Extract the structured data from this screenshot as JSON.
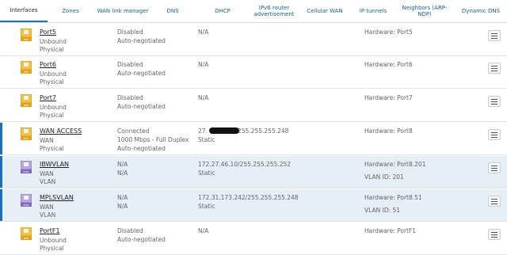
{
  "tabs": [
    {
      "label": "Interfaces"
    },
    {
      "label": "Zones"
    },
    {
      "label": "WAN link manager"
    },
    {
      "label": "DNS"
    },
    {
      "label": "DHCP"
    },
    {
      "label": "IPv6 router advertisement"
    },
    {
      "label": "Cellular WAN"
    },
    {
      "label": "IP tunnels"
    },
    {
      "label": "Neighbors (ARP-NDP)"
    },
    {
      "label": "Dynamic DNS"
    }
  ],
  "icon_text": {
    "eth": "eth",
    "vlan": "vlan"
  },
  "interfaces": [
    {
      "name": "Port5",
      "zone": "Unbound",
      "type": "Physical",
      "status": "Disabled",
      "speed": "Auto-negotiated",
      "ip": "N/A",
      "ip2": "",
      "hw": "Hardware: Port5",
      "vlan_id": "",
      "icon": "eth"
    },
    {
      "name": "Port6",
      "zone": "Unbound",
      "type": "Physical",
      "status": "Disabled",
      "speed": "Auto-negotiated",
      "ip": "N/A",
      "ip2": "",
      "hw": "Hardware: Port6",
      "vlan_id": "",
      "icon": "eth"
    },
    {
      "name": "Port7",
      "zone": "Unbound",
      "type": "Physical",
      "status": "Disabled",
      "speed": "Auto-negotiated",
      "ip": "N/A",
      "ip2": "",
      "hw": "Hardware: Port7",
      "vlan_id": "",
      "icon": "eth"
    },
    {
      "name": "WAN ACCESS",
      "zone": "WAN",
      "type": "Physical",
      "status": "Connected",
      "speed": "1000 Mbps - Full Duplex",
      "speed2": "Auto-negotiated",
      "ip": "27.",
      "ip_tail": "255.255.255.248",
      "ip2": "Static",
      "hw": "Hardware: Port8",
      "vlan_id": "",
      "icon": "eth"
    },
    {
      "name": "IBWVLAN",
      "zone": "WAN",
      "type": "VLAN",
      "status": "N/A",
      "speed": "N/A",
      "ip": "172.27.46.10/255.255.255.252",
      "ip2": "Static",
      "hw": "Hardware: Port8.201",
      "vlan_id": "VLAN ID: 201",
      "icon": "vlan"
    },
    {
      "name": "MPLSVLAN",
      "zone": "WAN",
      "type": "VLAN",
      "status": "N/A",
      "speed": "N/A",
      "ip": "172.31.173.242/255.255.255.248",
      "ip2": "Static",
      "hw": "Hardware: Port8.51",
      "vlan_id": "VLAN ID: 51",
      "icon": "vlan"
    },
    {
      "name": "PortF1",
      "zone": "Unbound",
      "type": "Physical",
      "status": "Disabled",
      "speed": "Auto-negotiated",
      "ip": "N/A",
      "ip2": "",
      "hw": "Hardware: PortF1",
      "vlan_id": "",
      "icon": "eth"
    }
  ]
}
